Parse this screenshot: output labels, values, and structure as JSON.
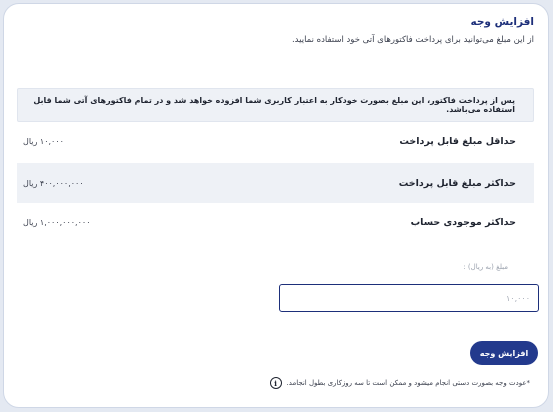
{
  "header": {
    "title": "افزایش وجه",
    "subtitle": "از این مبلغ می‌توانید برای پرداخت فاکتورهای آتی خود استفاده نمایید."
  },
  "notice": {
    "text": "پس از پرداخت فاکتور، این مبلغ بصورت خودکار به اعتبار کاربری شما افزوده خواهد شد و در تمام فاکتورهای آتی شما قابل استفاده می‌باشد."
  },
  "limits": [
    {
      "label": "حداقل مبلغ قابل پرداخت",
      "value": "۱۰,۰۰۰ ریال"
    },
    {
      "label": "حداکثر مبلغ قابل پرداخت",
      "value": "۴۰۰,۰۰۰,۰۰۰ ریال"
    },
    {
      "label": "حداکثر موجودی حساب",
      "value": "۱,۰۰۰,۰۰۰,۰۰۰ ریال"
    }
  ],
  "form": {
    "amount_label": "مبلغ (به ریال) :",
    "amount_placeholder": "۱۰,۰۰۰",
    "amount_value": "",
    "submit_label": "افزایش وجه"
  },
  "footnote": {
    "icon": "info-icon",
    "text": "*عودت وجه بصورت دستی انجام میشود و ممکن است تا سه روزکاری بطول انجامد."
  },
  "colors": {
    "accent": "#233a8d",
    "title": "#1d2f7a",
    "shaded_row": "#eef1f6",
    "background": "#e4e9f2"
  }
}
